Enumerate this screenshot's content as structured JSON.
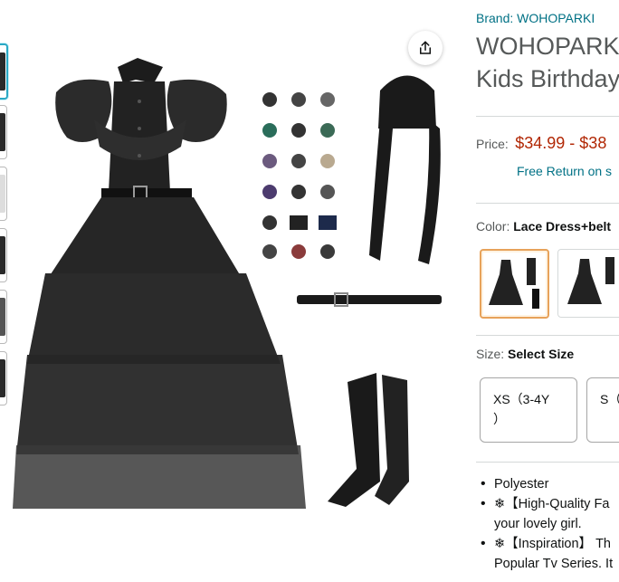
{
  "product": {
    "brand": "Brand: WOHOPARKI",
    "title_line1": "WOHOPARKI",
    "title_line2": "Kids Birthday"
  },
  "price": {
    "label": "Price:",
    "value": "$34.99 - $38",
    "return_text": "Free Return on s"
  },
  "color": {
    "label": "Color:",
    "selected": "Lace Dress+belt"
  },
  "size": {
    "label": "Size:",
    "selected": "Select Size",
    "options": [
      "XS（3-4Y\n）",
      "S（"
    ]
  },
  "bullets": [
    {
      "line1": "Polyester",
      "line2": ""
    },
    {
      "line1": "❄【High-Quality Fa",
      "line2": "your lovely girl."
    },
    {
      "line1": "❄【Inspiration】 Th",
      "line2": "Popular Tv Series. It"
    }
  ],
  "icons": {
    "share": "share-icon",
    "palette": {
      "dress": "#1c1c1c",
      "accent_orange": "#e7a25a",
      "link": "#007185",
      "price": "#b12704"
    }
  }
}
